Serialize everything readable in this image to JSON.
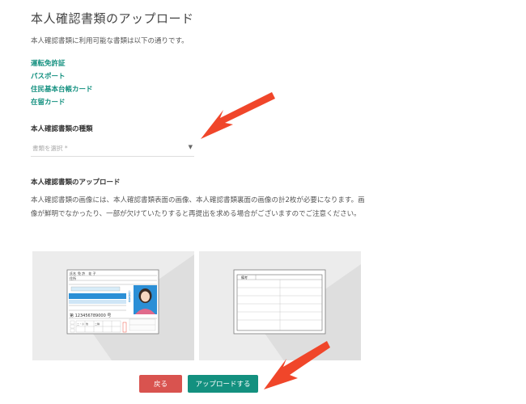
{
  "page": {
    "title": "本人確認書類のアップロード",
    "intro": "本人確認書類に利用可能な書類は以下の通りです。"
  },
  "documents": [
    {
      "label": "運転免許証"
    },
    {
      "label": "パスポート"
    },
    {
      "label": "住民基本台帳カード"
    },
    {
      "label": "在留カード"
    }
  ],
  "type_section": {
    "label": "本人確認書類の種類",
    "select_placeholder": "書類を選択 *"
  },
  "upload_section": {
    "label": "本人確認書類のアップロード",
    "description": "本人確認書類の画像には、本人確認書類表面の画像、本人確認書類裏面の画像の計2枚が必要になります。画像が鮮明でなかったり、一部が欠けていたりすると再提出を求める場合がございますのでご注意ください。"
  },
  "card_front": {
    "name_label": "氏名",
    "name_value": "免 許　花 子",
    "address_label": "住所",
    "number": "第 123456789000 号",
    "field_labels": [
      "二・小",
      "他",
      "二種"
    ],
    "side_text": "公安委員会"
  },
  "card_back": {
    "header_label": "備考"
  },
  "buttons": {
    "back": "戻る",
    "upload": "アップロードする"
  },
  "colors": {
    "accent": "#13907f",
    "danger": "#d9534f",
    "arrow": "#f0462a",
    "card_blue": "#2b8fd6"
  }
}
